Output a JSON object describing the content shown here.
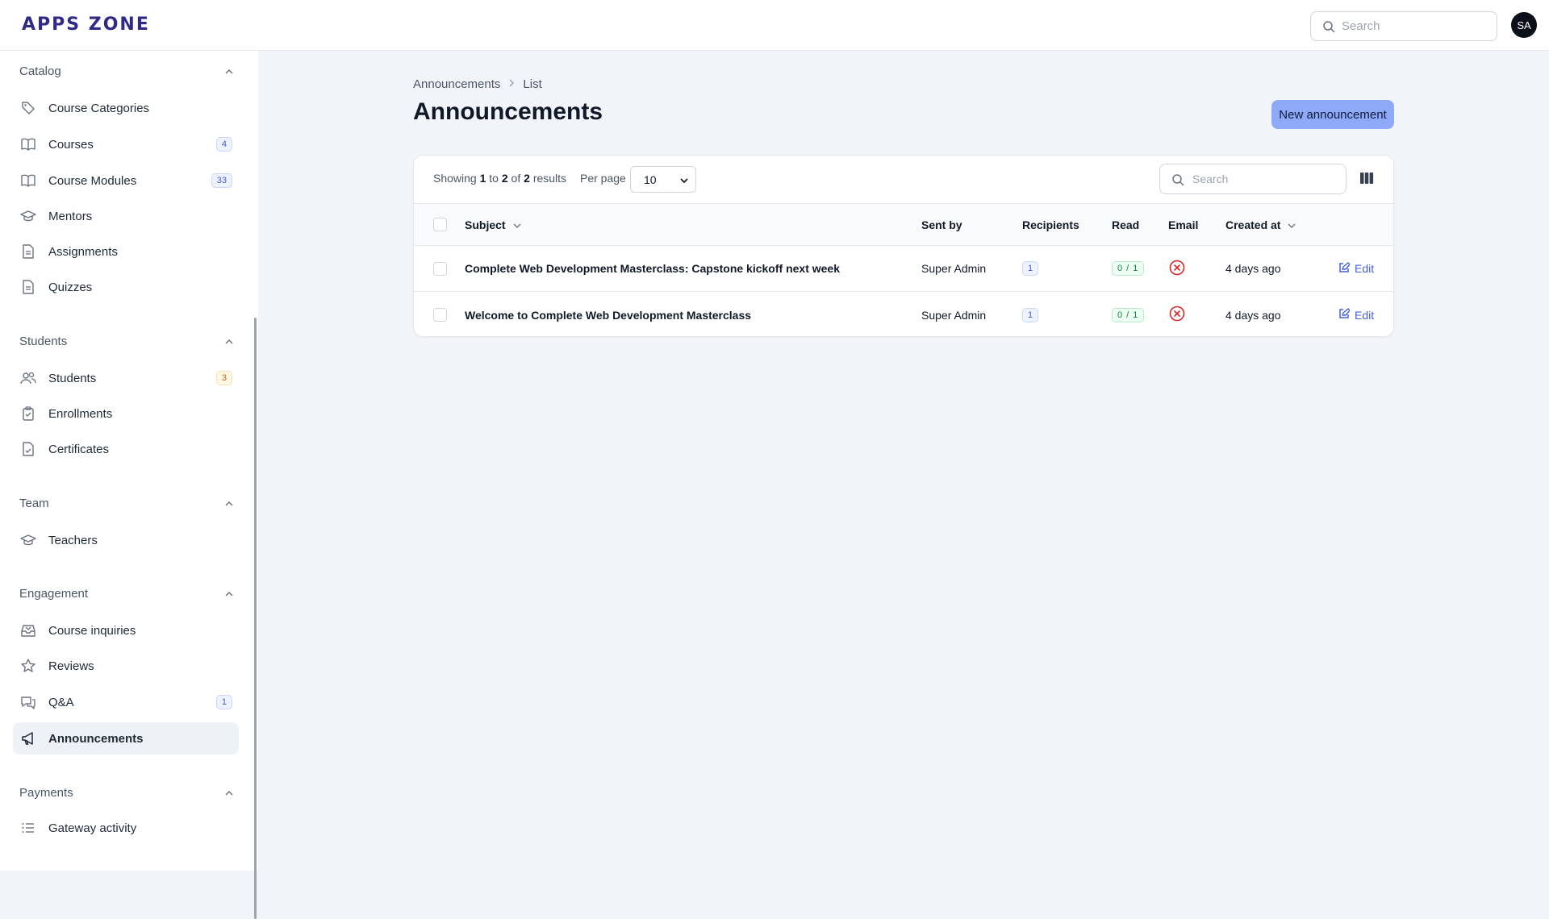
{
  "app": {
    "logo": "APPS ZONE",
    "search_placeholder": "Search",
    "avatar_initials": "SA"
  },
  "sidebar": {
    "groups": [
      {
        "title": "Catalog",
        "items": [
          {
            "label": "Course Categories",
            "icon": "tag-icon"
          },
          {
            "label": "Courses",
            "icon": "book-open-icon",
            "badge": "4"
          },
          {
            "label": "Course Modules",
            "icon": "book-open-icon",
            "badge": "33"
          },
          {
            "label": "Mentors",
            "icon": "academic-cap-icon"
          },
          {
            "label": "Assignments",
            "icon": "document-text-icon"
          },
          {
            "label": "Quizzes",
            "icon": "document-text-icon"
          }
        ]
      },
      {
        "title": "Students",
        "items": [
          {
            "label": "Students",
            "icon": "users-icon",
            "badge": "3"
          },
          {
            "label": "Enrollments",
            "icon": "clipboard-check-icon"
          },
          {
            "label": "Certificates",
            "icon": "document-check-icon"
          }
        ]
      },
      {
        "title": "Team",
        "items": [
          {
            "label": "Teachers",
            "icon": "academic-cap-icon"
          }
        ]
      },
      {
        "title": "Engagement",
        "items": [
          {
            "label": "Course inquiries",
            "icon": "inbox-icon"
          },
          {
            "label": "Reviews",
            "icon": "star-icon"
          },
          {
            "label": "Q&A",
            "icon": "chat-bubbles-icon",
            "badge": "1"
          },
          {
            "label": "Announcements",
            "icon": "megaphone-icon",
            "active": true
          }
        ]
      },
      {
        "title": "Payments",
        "items": [
          {
            "label": "Gateway activity",
            "icon": "list-icon"
          }
        ]
      }
    ]
  },
  "breadcrumb": {
    "parent": "Announcements",
    "current": "List"
  },
  "page": {
    "title": "Announcements",
    "new_button": "New announcement"
  },
  "table": {
    "showing": {
      "prefix": "Showing",
      "from": "1",
      "to_word": "to",
      "to": "2",
      "of_word": "of",
      "total": "2",
      "suffix": "results"
    },
    "per_page_label": "Per page",
    "per_page_value": "10",
    "search_placeholder": "Search",
    "columns": [
      "Subject",
      "Sent by",
      "Recipients",
      "Read",
      "Email",
      "Created at"
    ],
    "rows": [
      {
        "subject": "Complete Web Development Masterclass: Capstone kickoff next week",
        "sent_by": "Super Admin",
        "recipients": "1",
        "read": "0 / 1",
        "email": "not-sent",
        "created_at": "4 days ago",
        "action": "Edit"
      },
      {
        "subject": "Welcome to Complete Web Development Masterclass",
        "sent_by": "Super Admin",
        "recipients": "1",
        "read": "0 / 1",
        "email": "not-sent",
        "created_at": "4 days ago",
        "action": "Edit"
      }
    ]
  },
  "colors": {
    "logo": "#2f2a86",
    "primary_button": "#8ea9f8",
    "link": "#4461d8",
    "error": "#dc2626",
    "success": "#15803d"
  }
}
